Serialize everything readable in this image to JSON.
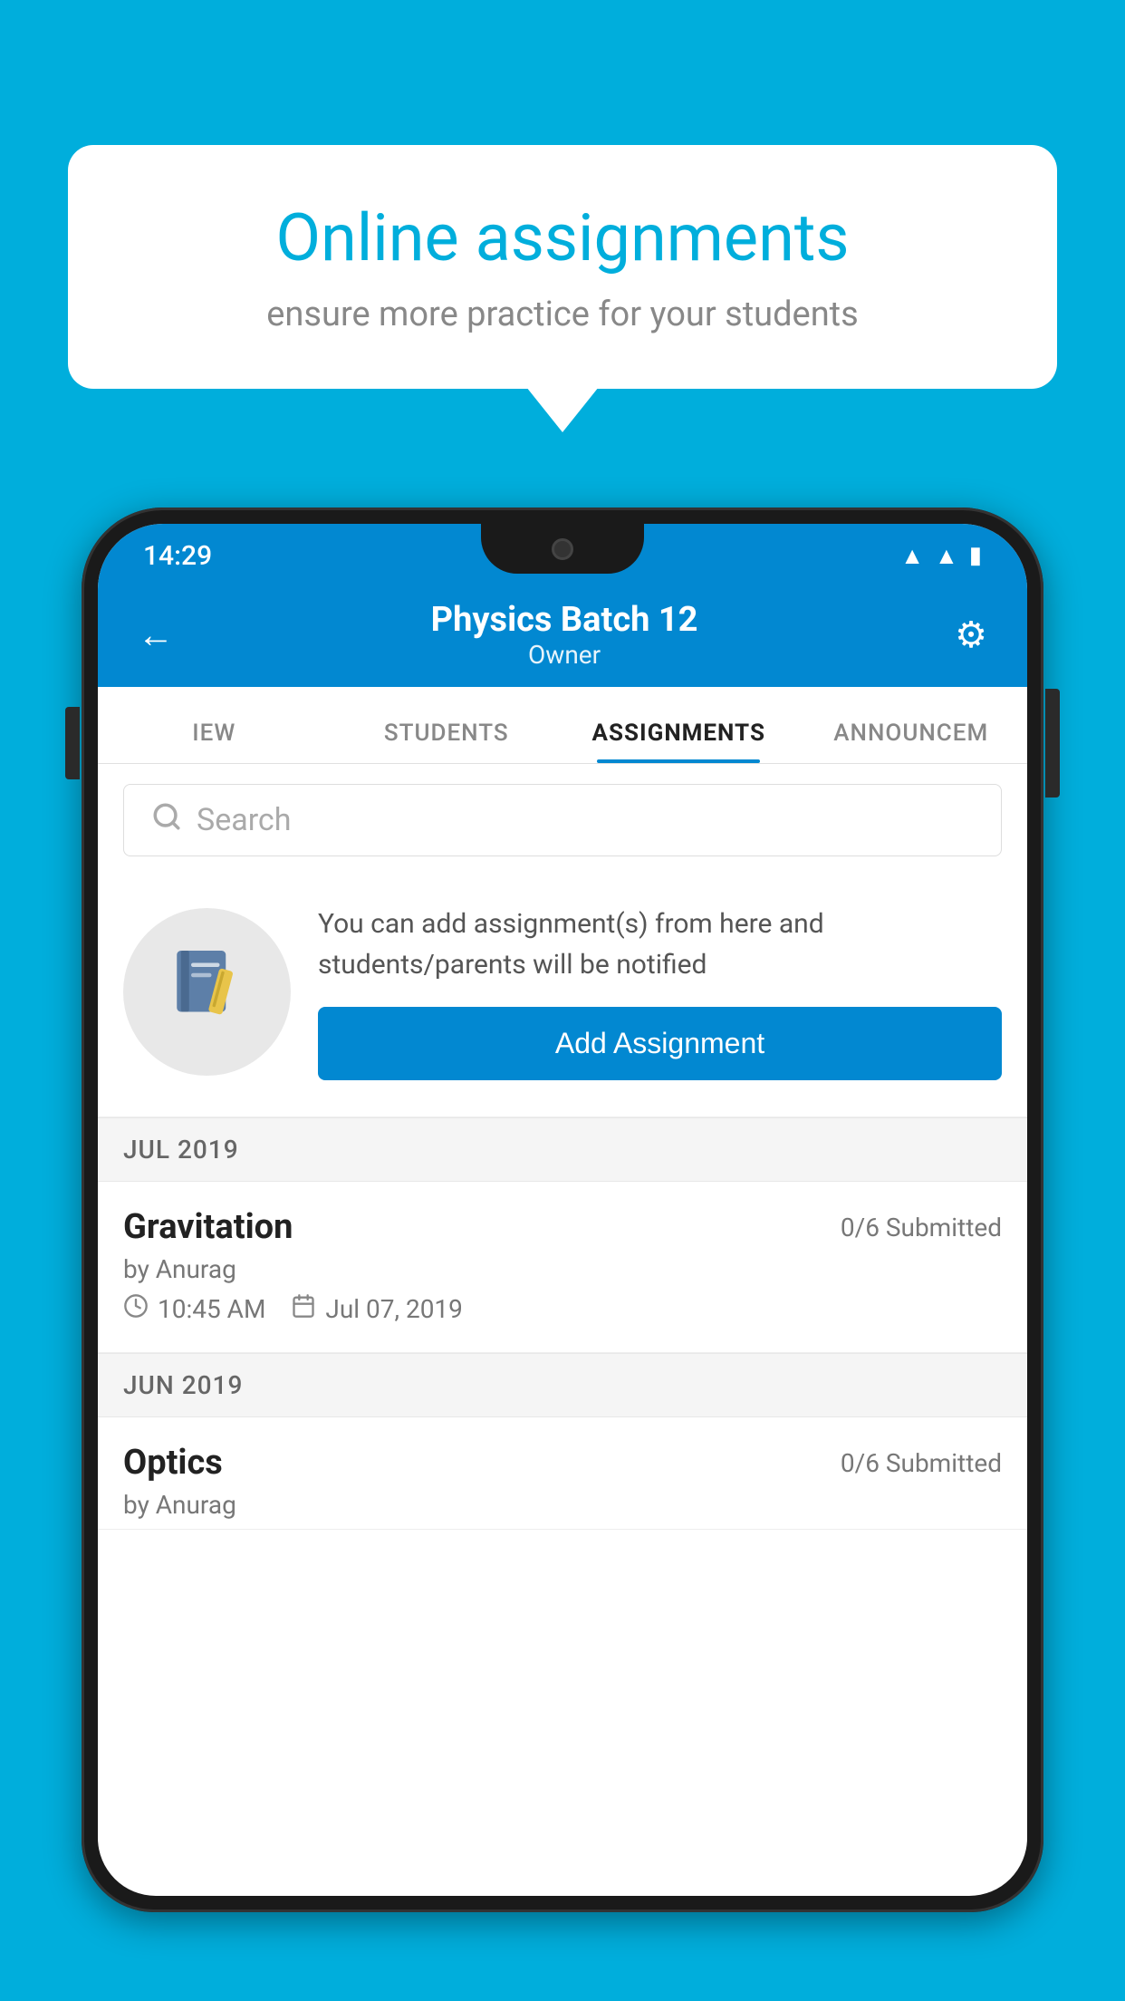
{
  "background_color": "#00AEDC",
  "speech_bubble": {
    "title": "Online assignments",
    "subtitle": "ensure more practice for your students"
  },
  "status_bar": {
    "time": "14:29",
    "icons": [
      "wifi",
      "signal",
      "battery"
    ]
  },
  "header": {
    "title": "Physics Batch 12",
    "subtitle": "Owner",
    "back_label": "←",
    "settings_label": "⚙"
  },
  "tabs": [
    {
      "label": "IEW",
      "active": false
    },
    {
      "label": "STUDENTS",
      "active": false
    },
    {
      "label": "ASSIGNMENTS",
      "active": true
    },
    {
      "label": "ANNOUNCEM",
      "active": false
    }
  ],
  "search": {
    "placeholder": "Search"
  },
  "promo": {
    "description": "You can add assignment(s) from here and students/parents will be notified",
    "button_label": "Add Assignment"
  },
  "sections": [
    {
      "month": "JUL 2019",
      "assignments": [
        {
          "name": "Gravitation",
          "submitted": "0/6 Submitted",
          "author": "by Anurag",
          "time": "10:45 AM",
          "date": "Jul 07, 2019"
        }
      ]
    },
    {
      "month": "JUN 2019",
      "assignments": [
        {
          "name": "Optics",
          "submitted": "0/6 Submitted",
          "author": "by Anurag",
          "time": "",
          "date": ""
        }
      ]
    }
  ]
}
